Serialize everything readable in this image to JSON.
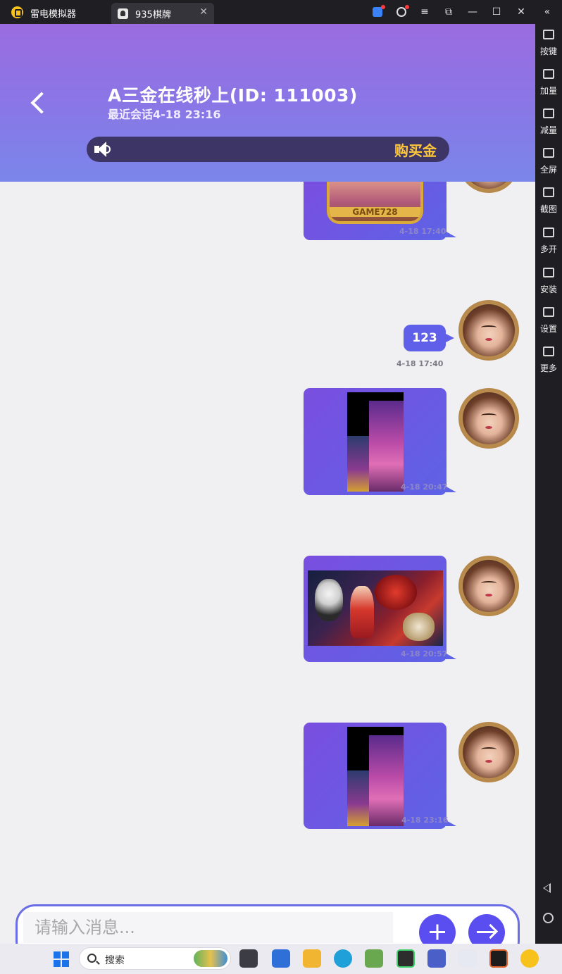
{
  "window": {
    "app_name": "雷电模拟器",
    "tab_label": "935棋牌",
    "tab_close": "✕",
    "controls": [
      "≡",
      "⧉",
      "—",
      "☐",
      "✕",
      "«"
    ]
  },
  "sidebar": {
    "items": [
      {
        "label": "按键",
        "icon": "keyboard-icon"
      },
      {
        "label": "加量",
        "icon": "volume-up-icon"
      },
      {
        "label": "减量",
        "icon": "volume-down-icon"
      },
      {
        "label": "全屏",
        "icon": "fullscreen-icon"
      },
      {
        "label": "截图",
        "icon": "scissors-icon"
      },
      {
        "label": "多开",
        "icon": "multi-instance-icon"
      },
      {
        "label": "安装",
        "icon": "apk-install-icon"
      },
      {
        "label": "设置",
        "icon": "settings-icon"
      },
      {
        "label": "更多",
        "icon": "more-icon"
      }
    ]
  },
  "header": {
    "title": "A三金在线秒上(ID: 111003)",
    "subtitle": "最近会话4-18 23:16",
    "buy_label": "购买金"
  },
  "messages": [
    {
      "type": "image",
      "image_label": "GAME728",
      "time": "4-18 17:40"
    },
    {
      "type": "text",
      "text": "123",
      "time": "4-18 17:40"
    },
    {
      "type": "image",
      "time": "4-18 20:47"
    },
    {
      "type": "image",
      "time": "4-18 20:57"
    },
    {
      "type": "image",
      "time": "4-18 23:16"
    }
  ],
  "input": {
    "placeholder": "请输入消息..."
  },
  "taskbar": {
    "search_label": "搜索"
  },
  "colors": {
    "accent": "#5a4ef0",
    "header_top": "#9a6ce0",
    "header_bottom": "#7a86ea",
    "buy_text": "#ffc83a"
  }
}
